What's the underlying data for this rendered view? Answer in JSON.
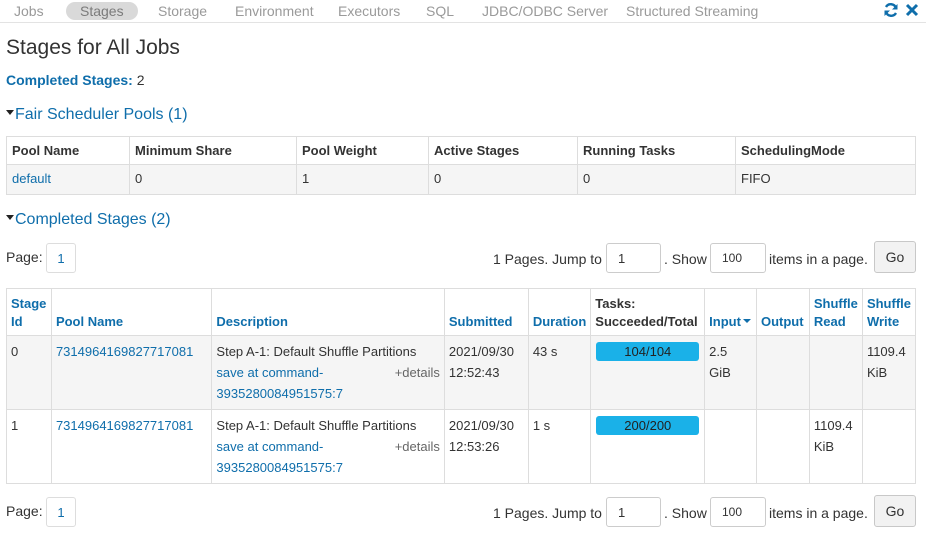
{
  "nav": {
    "tabs": [
      "Jobs",
      "Stages",
      "Storage",
      "Environment",
      "Executors",
      "SQL",
      "JDBC/ODBC Server",
      "Structured Streaming"
    ],
    "active_tab": "Stages",
    "icons": [
      "refresh-icon",
      "close-icon"
    ]
  },
  "page": {
    "title": "Stages for All Jobs",
    "summary_label": "Completed Stages:",
    "summary_value": "2"
  },
  "pools_section": {
    "header": "Fair Scheduler Pools (1)",
    "columns": [
      "Pool Name",
      "Minimum Share",
      "Pool Weight",
      "Active Stages",
      "Running Tasks",
      "SchedulingMode"
    ],
    "rows": [
      [
        "default",
        "0",
        "1",
        "0",
        "0",
        "FIFO"
      ]
    ]
  },
  "stages_section": {
    "header": "Completed Stages (2)",
    "pager": {
      "page_label": "Page:",
      "current_page": "1",
      "pages_text": "1 Pages. Jump to",
      "jump_value": "1",
      "show_text": ". Show",
      "page_size": "100",
      "items_text": "items in a page.",
      "go_label": "Go"
    },
    "columns": {
      "stage_id": "Stage Id",
      "pool_name": "Pool Name",
      "description": "Description",
      "submitted": "Submitted",
      "duration": "Duration",
      "tasks": "Tasks: Succeeded/Total",
      "input": "Input",
      "output": "Output",
      "shuffle_read": "Shuffle Read",
      "shuffle_write": "Shuffle Write"
    },
    "rows": [
      {
        "stage_id": "0",
        "pool_name": "7314964169827717081",
        "description": "Step A-1: Default Shuffle Partitions",
        "link": "save at command-3935280084951575:7",
        "details": "+details",
        "submitted": "2021/09/30 12:52:43",
        "duration": "43 s",
        "tasks": "104/104",
        "tasks_fraction": 1.0,
        "input": "2.5 GiB",
        "output": "",
        "shuffle_read": "",
        "shuffle_write": "1109.4 KiB"
      },
      {
        "stage_id": "1",
        "pool_name": "7314964169827717081",
        "description": "Step A-1: Default Shuffle Partitions",
        "link": "save at command-3935280084951575:7",
        "details": "+details",
        "submitted": "2021/09/30 12:53:26",
        "duration": "1 s",
        "tasks": "200/200",
        "tasks_fraction": 1.0,
        "input": "",
        "output": "",
        "shuffle_read": "1109.4 KiB",
        "shuffle_write": ""
      }
    ]
  },
  "colors": {
    "link": "#0f6eab",
    "progress": "#1ab1e8",
    "row_shade": "#f5f5f5"
  }
}
